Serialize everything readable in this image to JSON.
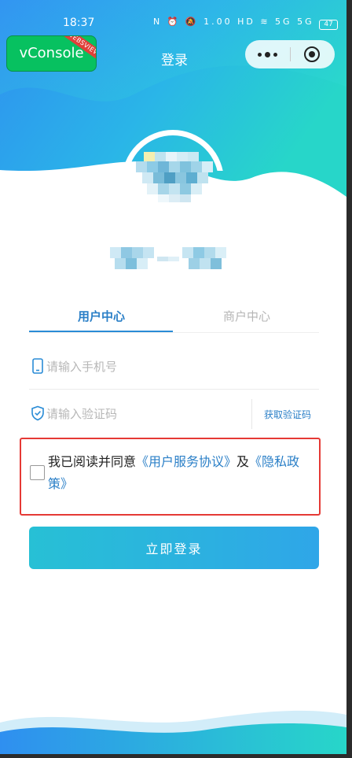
{
  "status_bar": {
    "time": "18:37",
    "icons": "N ⏰ 🔕 1.00 HD ≋ 5G 5G",
    "speed_top": "1.00",
    "speed_bottom": "KB/S",
    "battery": "47"
  },
  "vconsole": {
    "label": "vConsole",
    "ribbon": "WEBSVIEW"
  },
  "header": {
    "title": "登录",
    "more_icon": "more-dots-icon",
    "close_icon": "target-close-icon"
  },
  "tabs": [
    {
      "label": "用户中心",
      "active": true
    },
    {
      "label": "商户中心",
      "active": false
    }
  ],
  "form": {
    "phone_placeholder": "请输入手机号",
    "code_placeholder": "请输入验证码",
    "get_code_label": "获取验证码",
    "phone_icon": "phone-icon",
    "code_icon": "shield-icon"
  },
  "agreement": {
    "prefix": "我已阅读并同意",
    "service_link": "《用户服务协议》",
    "conjunction": "及",
    "privacy_link": "《隐私政策》",
    "checked": false
  },
  "login_button": "立即登录",
  "colors": {
    "accent": "#2a7fc7",
    "button_start": "#27c0d5",
    "button_end": "#2fa6e8",
    "highlight_border": "#e53935",
    "vconsole_green": "#07c160"
  }
}
